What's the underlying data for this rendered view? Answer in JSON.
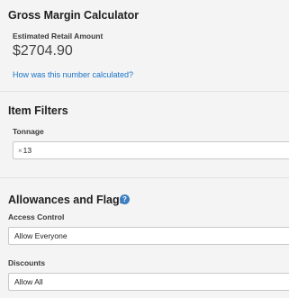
{
  "calculator": {
    "title": "Gross Margin Calculator",
    "amount_label": "Estimated Retail Amount",
    "amount_value": "$2704.90",
    "help_link": "How was this number calculated?"
  },
  "filters": {
    "title": "Item Filters",
    "tonnage_label": "Tonnage",
    "tonnage_tag_remove": "×",
    "tonnage_tag_value": "13"
  },
  "allowances": {
    "title": "Allowances and Flags",
    "help_icon": "?",
    "access_label": "Access Control",
    "access_value": "Allow Everyone",
    "discounts_label": "Discounts",
    "discounts_value": "Allow All"
  },
  "icons": {
    "help": "question-circle-icon",
    "tag_remove": "close-icon"
  },
  "colors": {
    "background": "#f4f4f4",
    "link": "#1a73c8",
    "help_icon": "#3d7fc1"
  }
}
